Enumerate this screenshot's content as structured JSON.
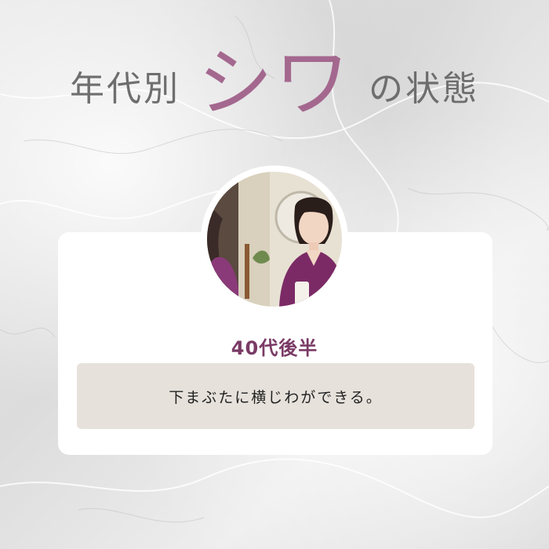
{
  "title": {
    "prefix": "年代別",
    "emphasis": "シワ",
    "suffix": "の状態"
  },
  "card": {
    "age_label": "40代後半",
    "description": "下まぶたに横じわができる。"
  },
  "colors": {
    "accent": "#a4688f",
    "age_label": "#7a3a65",
    "title_gray": "#6e6e6e",
    "desc_bg": "#e6e1db",
    "scrubs": "#7b2a66"
  },
  "avatar": {
    "icon": "person-photo"
  }
}
